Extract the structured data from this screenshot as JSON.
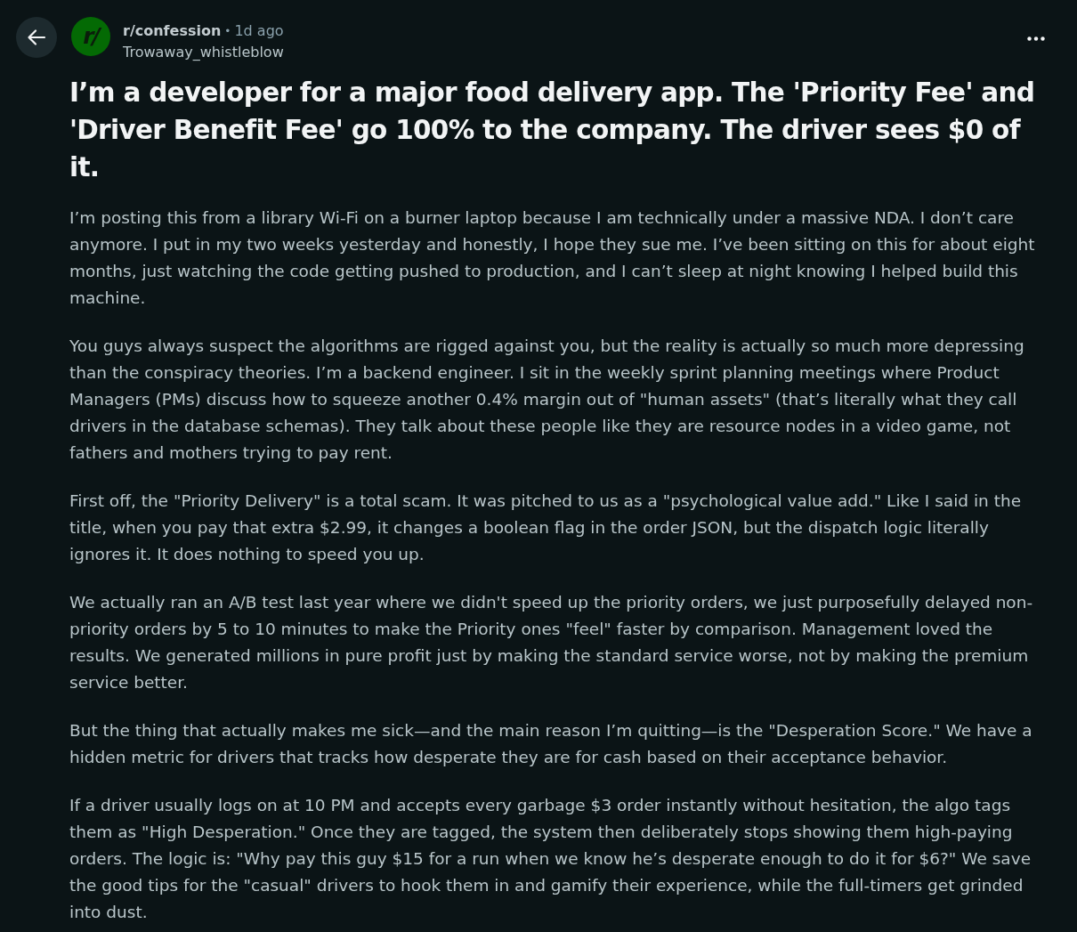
{
  "post_header": {
    "subreddit_icon_text": "r/",
    "subreddit": "r/confession",
    "separator": "•",
    "time": "1d ago",
    "author": "Trowaway_whistleblow"
  },
  "post": {
    "title": "I’m a developer for a major food delivery app. The 'Priority Fee' and 'Driver Benefit Fee' go 100% to the company. The driver sees $0 of it.",
    "paragraphs": [
      "I’m posting this from a library Wi-Fi on a burner laptop because I am technically under a massive NDA. I don’t care anymore. I put in my two weeks yesterday and honestly, I hope they sue me. I’ve been sitting on this for about eight months, just watching the code getting pushed to production, and I can’t sleep at night knowing I helped build this machine.",
      "You guys always suspect the algorithms are rigged against you, but the reality is actually so much more depressing than the conspiracy theories. I’m a backend engineer. I sit in the weekly sprint planning meetings where Product Managers (PMs) discuss how to squeeze another 0.4% margin out of \"human assets\" (that’s literally what they call drivers in the database schemas). They talk about these people like they are resource nodes in a video game, not fathers and mothers trying to pay rent.",
      "First off, the \"Priority Delivery\" is a total scam. It was pitched to us as a \"psychological value add.\" Like I said in the title, when you pay that extra $2.99, it changes a boolean flag in the order JSON, but the dispatch logic literally ignores it. It does nothing to speed you up.",
      "We actually ran an A/B test last year where we didn't speed up the priority orders, we just purposefully delayed non-priority orders by 5 to 10 minutes to make the Priority ones \"feel\" faster by comparison. Management loved the results. We generated millions in pure profit just by making the standard service worse, not by making the premium service better.",
      "But the thing that actually makes me sick—and the main reason I’m quitting—is the \"Desperation Score.\" We have a hidden metric for drivers that tracks how desperate they are for cash based on their acceptance behavior.",
      "If a driver usually logs on at 10 PM and accepts every garbage $3 order instantly without hesitation, the algo tags them as \"High Desperation.\" Once they are tagged, the system then deliberately stops showing them high-paying orders. The logic is: \"Why pay this guy $15 for a run when we know he’s desperate enough to do it for $6?\" We save the good tips for the \"casual\" drivers to hook them in and gamify their experience, while the full-timers get grinded into dust."
    ]
  }
}
